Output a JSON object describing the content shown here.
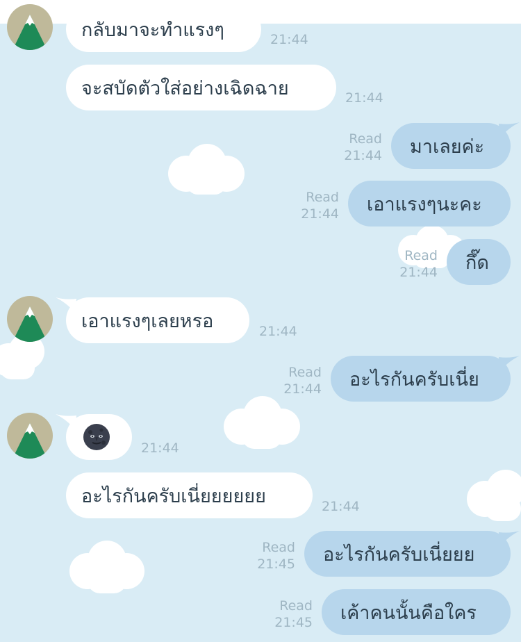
{
  "messages": [
    {
      "side": "in",
      "text": "กลับมาจะทำแรงๆ",
      "time": "21:44"
    },
    {
      "side": "in",
      "text": "จะสบัดตัวใส่อย่างเฉิดฉาย",
      "time": "21:44"
    },
    {
      "side": "out",
      "text": "มาเลยค่ะ",
      "read": "Read",
      "time": "21:44"
    },
    {
      "side": "out",
      "text": "เอาแรงๆนะคะ",
      "read": "Read",
      "time": "21:44"
    },
    {
      "side": "out",
      "text": "กึ๊ด",
      "read": "Read",
      "time": "21:44"
    },
    {
      "side": "in",
      "text": "เอาแรงๆเลยหรอ",
      "time": "21:44"
    },
    {
      "side": "out",
      "text": "อะไรกันครับเนี่ย",
      "read": "Read",
      "time": "21:44"
    },
    {
      "side": "in",
      "emoji": "new-moon-face-emoji",
      "time": "21:44"
    },
    {
      "side": "in",
      "text": "อะไรกันครับเนี่ยยยยยย",
      "time": "21:44"
    },
    {
      "side": "out",
      "text": "อะไรกันครับเนี่ยยย",
      "read": "Read",
      "time": "21:45"
    },
    {
      "side": "out",
      "text": "เค้าคนนั้นคือใคร",
      "read": "Read",
      "time": "21:45"
    }
  ],
  "colors": {
    "background": "#d9ecf5",
    "incoming": "#ffffff",
    "outgoing": "#b7d6ec",
    "avatar_bg": "#bfb99a",
    "avatar_mountain": "#1e8a57"
  }
}
